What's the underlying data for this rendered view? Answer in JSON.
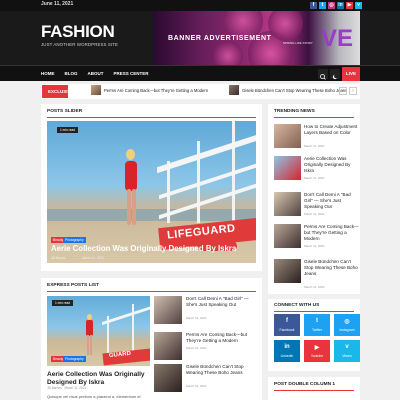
{
  "topbar": {
    "date": "June 11, 2021",
    "socials": [
      {
        "icon": "facebook-icon",
        "glyph": "f",
        "color": "#3b5998"
      },
      {
        "icon": "twitter-icon",
        "glyph": "t",
        "color": "#1da1f2"
      },
      {
        "icon": "instagram-icon",
        "glyph": "◎",
        "color": "#c13584"
      },
      {
        "icon": "linkedin-icon",
        "glyph": "in",
        "color": "#0077b5"
      },
      {
        "icon": "youtube-icon",
        "glyph": "▶",
        "color": "#e8343c"
      },
      {
        "icon": "vimeo-icon",
        "glyph": "v",
        "color": "#1ab7ea"
      }
    ]
  },
  "header": {
    "logo": "FASHION",
    "tagline": "JUST ANOTHER WORDPRESS SITE",
    "banner_text": "BANNER ADVERTISEMENT",
    "banner_letter": "VE",
    "banner_sub": "SPRING  LIFE STORY"
  },
  "nav": {
    "links": [
      "HOME",
      "BLOG",
      "ABOUT",
      "PRESS CENTER"
    ],
    "live_label": "LIVE"
  },
  "ticker": {
    "label": "EXCLUSIVE",
    "items": [
      "Perms Are Coming Back—but They're Getting a Modern",
      "Gisele Bündchen Can't Stop Wearing These Boho Jeans"
    ]
  },
  "posts_slider": {
    "title": "POSTS SLIDER",
    "badge": "1 min read",
    "tags": [
      "Beauty",
      "Photography"
    ],
    "headline": "Aerie Collection Was Originally Designed By Iskra",
    "author": "Jill Barnes",
    "date": "March 11, 2021",
    "sign_text": "LIFEGUARD"
  },
  "trending": {
    "title": "TRENDING NEWS",
    "items": [
      {
        "title": "How to Create Adjustment Layers Based on Color",
        "date": "March 11, 2021"
      },
      {
        "title": "Aerie Collection Was Originally Designed By Iskra",
        "date": "March 11, 2021"
      },
      {
        "title": "Don't Call Demi A \"Bad Girl\" — She's Just Speaking Out",
        "date": "March 11, 2021"
      },
      {
        "title": "Perms Are Coming Back—but They're Getting a Modern",
        "date": "March 11, 2021"
      },
      {
        "title": "Gisele Bündchen Can't Stop Wearing These Boho Jeans",
        "date": "March 11, 2021"
      }
    ]
  },
  "express": {
    "title": "EXPRESS POSTS LIST",
    "badge": "1 min read",
    "tags": [
      "Beauty",
      "Photography"
    ],
    "headline": "Aerie Collection Was Originally Designed By Iskra",
    "author": "Jill Barnes",
    "date": "March 11, 2021",
    "excerpt": "Quisque vel risus pretium a placerat a, elementum et",
    "sign_text": "GUARD",
    "side_items": [
      {
        "title": "Don't Call Demi A \"Bad Girl\" — She's Just Speaking Out",
        "date": "March 11, 2021"
      },
      {
        "title": "Perms Are Coming Back—but They're Getting a Modern",
        "date": "March 11, 2021"
      },
      {
        "title": "Gisele Bündchen Can't Stop Wearing These Boho Jeans",
        "date": "March 11, 2021"
      }
    ]
  },
  "connect": {
    "title": "CONNECT WITH US",
    "networks": [
      {
        "label": "Facebook",
        "glyph": "f",
        "color": "#3b5998",
        "icon": "facebook-icon"
      },
      {
        "label": "Twitter",
        "glyph": "t",
        "color": "#1da1f2",
        "icon": "twitter-icon"
      },
      {
        "label": "Instagram",
        "glyph": "◎",
        "color": "#1da1f2",
        "icon": "instagram-icon"
      },
      {
        "label": "Linkedin",
        "glyph": "in",
        "color": "#0077b5",
        "icon": "linkedin-icon"
      },
      {
        "label": "Youtube",
        "glyph": "▶",
        "color": "#e8343c",
        "icon": "youtube-icon"
      },
      {
        "label": "Vimeo",
        "glyph": "v",
        "color": "#1ab7ea",
        "icon": "vimeo-icon"
      }
    ]
  },
  "double_column": {
    "title": "POST DOUBLE COLUMN 1"
  },
  "colors": {
    "accent": "#e8343c"
  }
}
